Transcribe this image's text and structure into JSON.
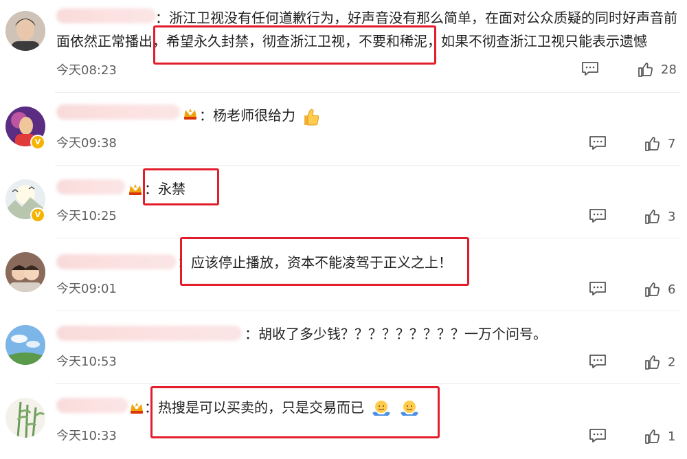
{
  "comments": [
    {
      "text_line1": "：浙江卫视没有任何道歉行为，好声音没有那么简单，在面对公众质疑的同时好声音前",
      "text_line2": "面依然正常播出，希望永久封禁，彻查浙江卫视，不要和稀泥，如果不彻查浙江卫视只能表示遗憾",
      "time": "今天08:23",
      "likes": "28"
    },
    {
      "text": "杨老师很给力",
      "time": "今天09:38",
      "likes": "7"
    },
    {
      "text": "永禁",
      "time": "今天10:25",
      "likes": "3"
    },
    {
      "text": "应该停止播放，资本不能凌驾于正义之上！",
      "time": "今天09:01",
      "likes": "6"
    },
    {
      "text": "：胡收了多少钱？？？？？？？？？一万个问号。",
      "time": "今天10:53",
      "likes": "2"
    },
    {
      "text": "热搜是可以买卖的，只是交易而已",
      "time": "今天10:33",
      "likes": "1"
    }
  ],
  "colors": {
    "highlight": "#e21c2a",
    "vip_badge": "#f5b400",
    "blurred_name": "#f0a8a8"
  },
  "icons": {
    "reply": "comment-bubble-icon",
    "like": "thumbs-up-icon",
    "verified": "verified-v-icon",
    "member": "crown-member-icon"
  }
}
